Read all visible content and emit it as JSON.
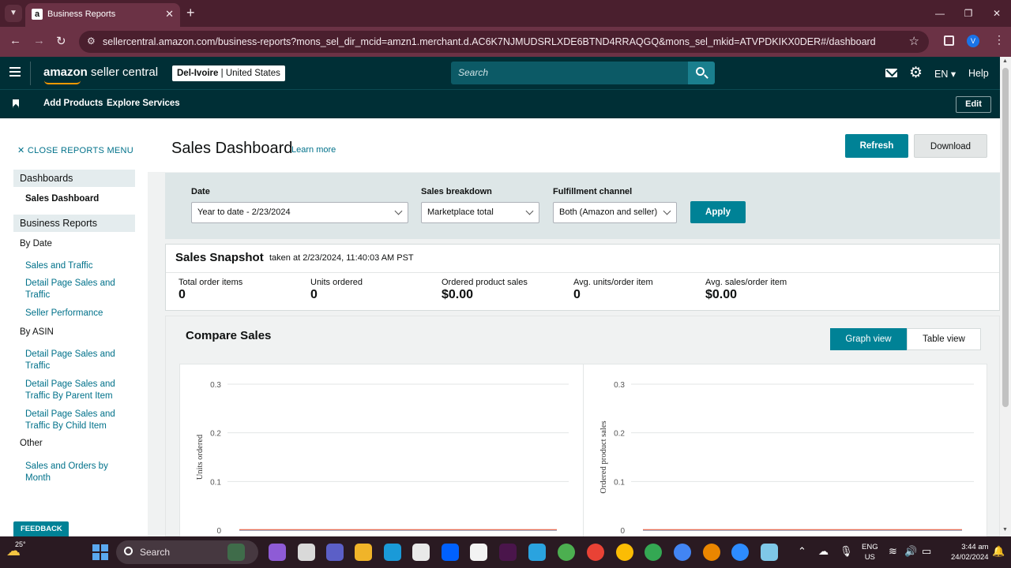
{
  "browser": {
    "tab_title": "Business Reports",
    "url": "sellercentral.amazon.com/business-reports?mons_sel_dir_mcid=amzn1.merchant.d.AC6K7NJMUDSRLXDE6BTND4RRAQGQ&mons_sel_mkid=ATVPDKIKX0DER#/dashboard",
    "profile_initial": "V"
  },
  "header": {
    "logo_bold": "amazon",
    "logo_light": "seller central",
    "store_name": "Del-Ivoire",
    "store_region": "United States",
    "search_placeholder": "Search",
    "language": "EN",
    "help": "Help"
  },
  "subnav": {
    "add_products": "Add Products",
    "explore_services": "Explore Services",
    "edit": "Edit"
  },
  "sidebar": {
    "close_menu": "CLOSE REPORTS MENU",
    "dashboards": "Dashboards",
    "sales_dashboard": "Sales Dashboard",
    "business_reports": "Business Reports",
    "by_date": "By Date",
    "by_date_links": [
      "Sales and Traffic",
      "Detail Page Sales and Traffic",
      "Seller Performance"
    ],
    "by_asin": "By ASIN",
    "by_asin_links": [
      "Detail Page Sales and Traffic",
      "Detail Page Sales and Traffic By Parent Item",
      "Detail Page Sales and Traffic By Child Item"
    ],
    "other": "Other",
    "other_links": [
      "Sales and Orders by Month"
    ],
    "feedback": "FEEDBACK"
  },
  "page": {
    "title": "Sales Dashboard",
    "learn_more": "Learn more",
    "refresh": "Refresh",
    "download": "Download"
  },
  "filters": {
    "date_label": "Date",
    "date_value": "Year to date - 2/23/2024",
    "breakdown_label": "Sales breakdown",
    "breakdown_value": "Marketplace total",
    "channel_label": "Fulfillment channel",
    "channel_value": "Both (Amazon and seller)",
    "apply": "Apply"
  },
  "snapshot": {
    "title": "Sales Snapshot",
    "taken": "taken at 2/23/2024, 11:40:03 AM PST",
    "metrics": [
      {
        "label": "Total order items",
        "value": "0"
      },
      {
        "label": "Units ordered",
        "value": "0"
      },
      {
        "label": "Ordered product sales",
        "value": "$0.00"
      },
      {
        "label": "Avg. units/order item",
        "value": "0"
      },
      {
        "label": "Avg. sales/order item",
        "value": "$0.00"
      }
    ]
  },
  "compare": {
    "title": "Compare Sales",
    "graph_view": "Graph view",
    "table_view": "Table view"
  },
  "chart_data": [
    {
      "type": "line",
      "ylabel": "Units ordered",
      "yticks": [
        "0.3",
        "0.2",
        "0.1",
        "0"
      ],
      "ylim": [
        0,
        0.3
      ],
      "series": [
        {
          "values": [
            0,
            0
          ],
          "color": "#4aa3df"
        },
        {
          "values": [
            0,
            0
          ],
          "color": "#e8735a"
        }
      ]
    },
    {
      "type": "line",
      "ylabel": "Ordered product sales",
      "yticks": [
        "0.3",
        "0.2",
        "0.1",
        "0"
      ],
      "ylim": [
        0,
        0.3
      ],
      "series": [
        {
          "values": [
            0,
            0
          ],
          "color": "#4aa3df"
        },
        {
          "values": [
            0,
            0
          ],
          "color": "#e8735a"
        }
      ]
    }
  ],
  "taskbar": {
    "temperature": "25°",
    "search": "Search",
    "lang_line1": "ENG",
    "lang_line2": "US",
    "time": "3:44 am",
    "date": "24/02/2024"
  },
  "colors": {
    "accent": "#008296",
    "header": "#002f36",
    "browser": "#6b3245"
  }
}
